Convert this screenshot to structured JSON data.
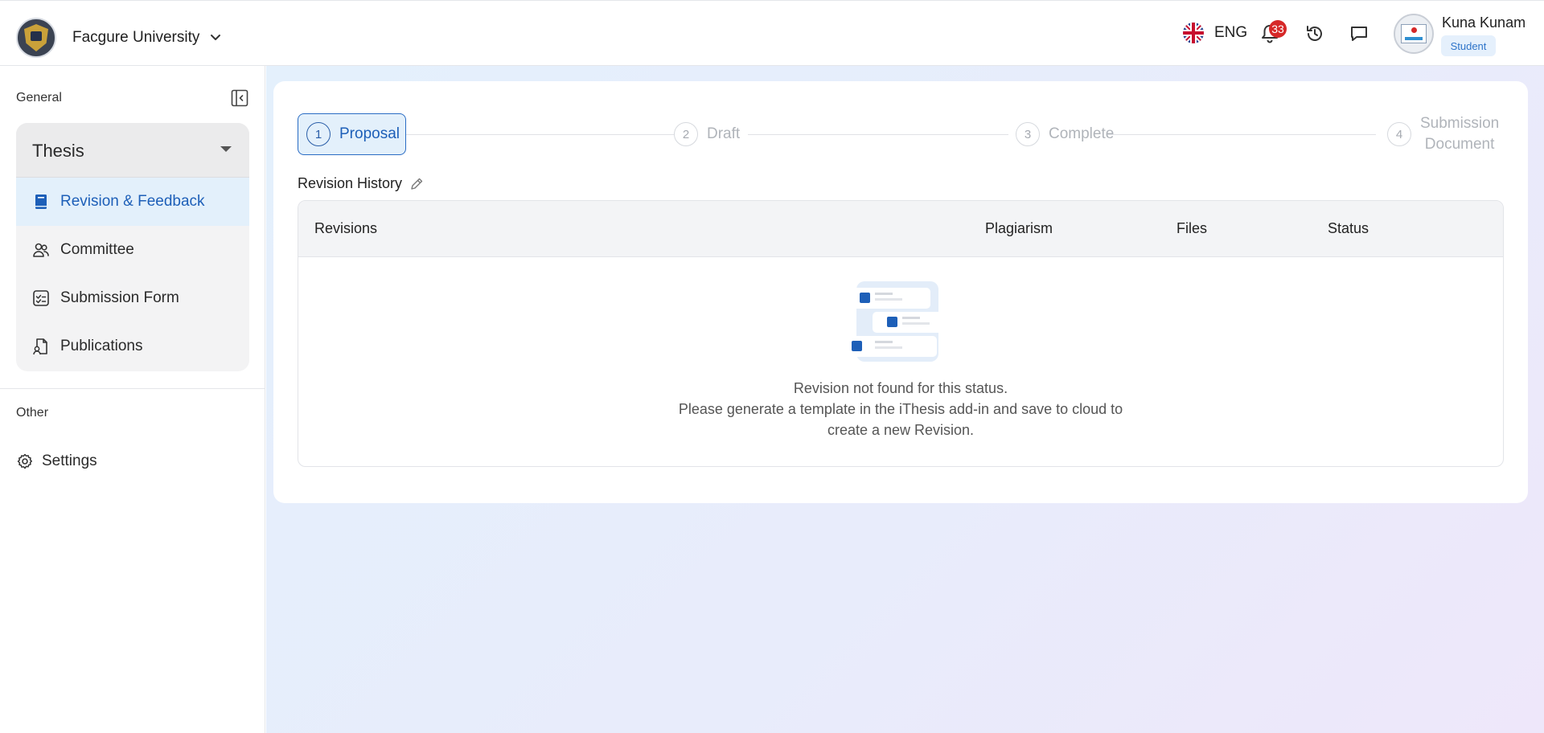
{
  "header": {
    "university": "Facgure University",
    "language": "ENG",
    "notification_count": "33",
    "user_name": "Kuna Kunam",
    "user_role": "Student"
  },
  "sidebar": {
    "general_label": "General",
    "group_title": "Thesis",
    "items": [
      {
        "label": "Revision & Feedback",
        "icon": "book-icon",
        "active": true
      },
      {
        "label": "Committee",
        "icon": "users-icon"
      },
      {
        "label": "Submission Form",
        "icon": "checklist-icon"
      },
      {
        "label": "Publications",
        "icon": "document-person-icon"
      }
    ],
    "other_label": "Other",
    "settings_label": "Settings"
  },
  "stepper": {
    "steps": [
      {
        "num": "1",
        "label": "Proposal",
        "active": true
      },
      {
        "num": "2",
        "label": "Draft"
      },
      {
        "num": "3",
        "label": "Complete"
      },
      {
        "num": "4",
        "label_line1": "Submission",
        "label_line2": "Document"
      }
    ]
  },
  "revision_history": {
    "title": "Revision History",
    "columns": [
      "Revisions",
      "Plagiarism",
      "Files",
      "Status"
    ],
    "empty_line1": "Revision not found for this status.",
    "empty_line2": "Please generate a template in the iThesis add-in and save to cloud to",
    "empty_line3": "create a new Revision."
  },
  "colors": {
    "accent": "#1d5fb8",
    "active_bg": "#e3f0fb",
    "badge": "#d62828"
  }
}
